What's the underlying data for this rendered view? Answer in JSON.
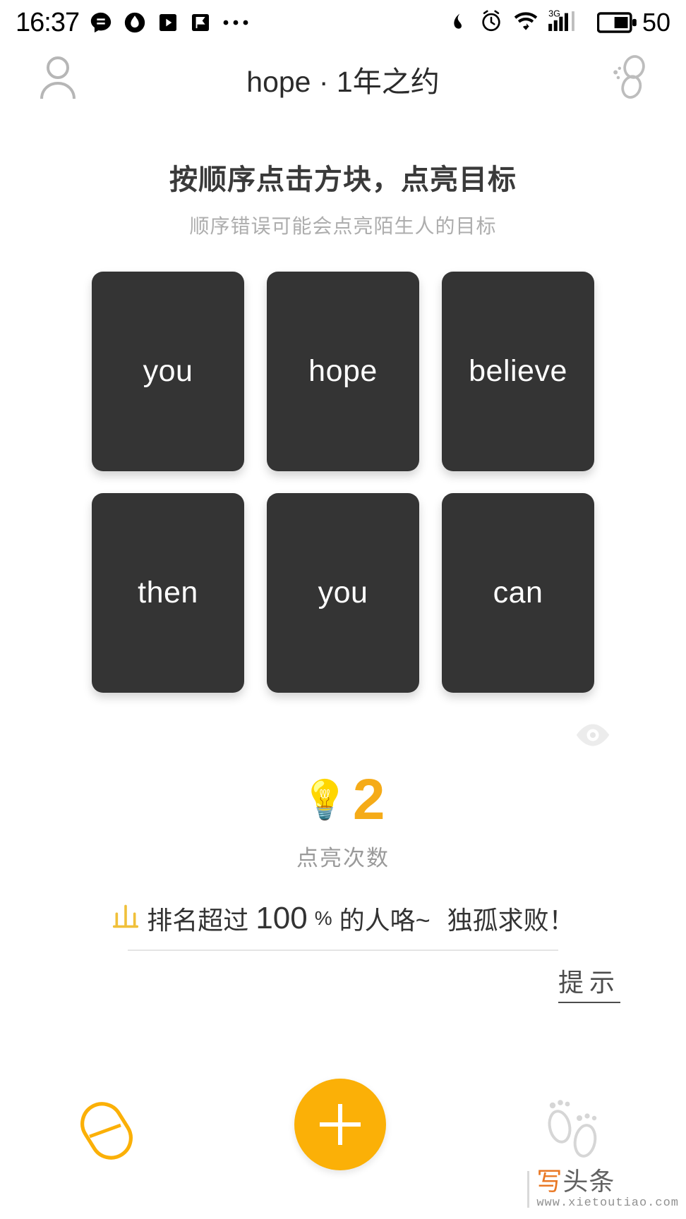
{
  "status_bar": {
    "time": "16:37",
    "battery_percent": "50",
    "network": "3G",
    "left_icons": [
      "message-icon",
      "app-circle-icon",
      "play-icon",
      "flag-icon",
      "more-dots-icon"
    ],
    "right_icons": [
      "mute-icon",
      "alarm-icon",
      "wifi-icon",
      "signal-icon",
      "battery-icon"
    ]
  },
  "header": {
    "title": "hope · 1年之约",
    "left_icon": "user-avatar-icon",
    "right_icon": "share-icon"
  },
  "instructions": {
    "main": "按顺序点击方块，点亮目标",
    "sub": "顺序错误可能会点亮陌生人的目标"
  },
  "grid": {
    "cards": [
      {
        "label": "you"
      },
      {
        "label": "hope"
      },
      {
        "label": "believe"
      },
      {
        "label": "then"
      },
      {
        "label": "you"
      },
      {
        "label": "can"
      }
    ]
  },
  "eye": {
    "icon": "eye-icon"
  },
  "counter": {
    "bulb_icon": "💡",
    "value": "2",
    "label": "点亮次数",
    "color": "#f5ab18"
  },
  "rank": {
    "icon": "mountain-chart-icon",
    "prefix": "排名超过",
    "percent": "100",
    "percent_symbol": "%",
    "suffix": "的人咯~",
    "tail": "独孤求败！",
    "icon_color": "#f0c03a"
  },
  "hint": {
    "label": "提示"
  },
  "bottom_bar": {
    "left_icon": "capsule-pill-icon",
    "center_icon": "plus-icon",
    "right_icon": "footprints-icon",
    "accent_color": "#fbb007"
  },
  "watermark": {
    "brand_first": "写",
    "brand_rest": "头条",
    "url": "www.xietoutiao.com"
  }
}
